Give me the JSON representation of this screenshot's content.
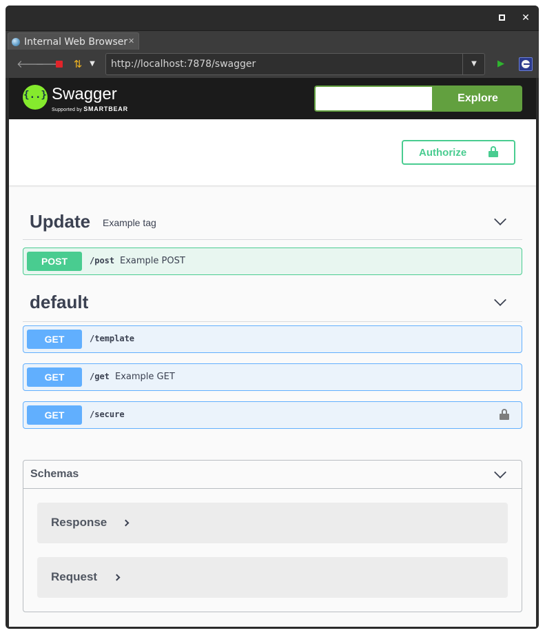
{
  "window": {
    "maximize_icon": "maximize-icon",
    "close_glyph": "✕"
  },
  "browser": {
    "tab_title": "Internal Web Browser",
    "tab_close_glyph": "✕",
    "url": "http://localhost:7878/swagger",
    "icons": [
      "back-arrow-icon",
      "forward-arrow-icon",
      "stop-icon",
      "refresh-icon",
      "dropdown-icon",
      "go-icon",
      "eclipse-icon"
    ]
  },
  "swagger_header": {
    "logo_glyph": "{..}",
    "brand": "Swagger",
    "supported_by": "Supported by",
    "smartbear": "SMARTBEAR",
    "search_value": "",
    "explore_label": "Explore",
    "brand_color": "#62a03f",
    "logo_color": "#85ea2d"
  },
  "scheme": {
    "authorize_label": "Authorize",
    "authorize_color": "#49cc90"
  },
  "tags": [
    {
      "name": "Update",
      "description": "Example tag",
      "operations": [
        {
          "method": "POST",
          "path": "/post",
          "summary": "Example POST",
          "locked": false
        }
      ]
    },
    {
      "name": "default",
      "description": "",
      "operations": [
        {
          "method": "GET",
          "path": "/template",
          "summary": "",
          "locked": false
        },
        {
          "method": "GET",
          "path": "/get",
          "summary": "Example GET",
          "locked": false
        },
        {
          "method": "GET",
          "path": "/secure",
          "summary": "",
          "locked": true
        }
      ]
    }
  ],
  "schemas": {
    "title": "Schemas",
    "models": [
      "Response",
      "Request"
    ]
  },
  "colors": {
    "post": "#49cc90",
    "get": "#61affe",
    "text": "#3b4151"
  }
}
